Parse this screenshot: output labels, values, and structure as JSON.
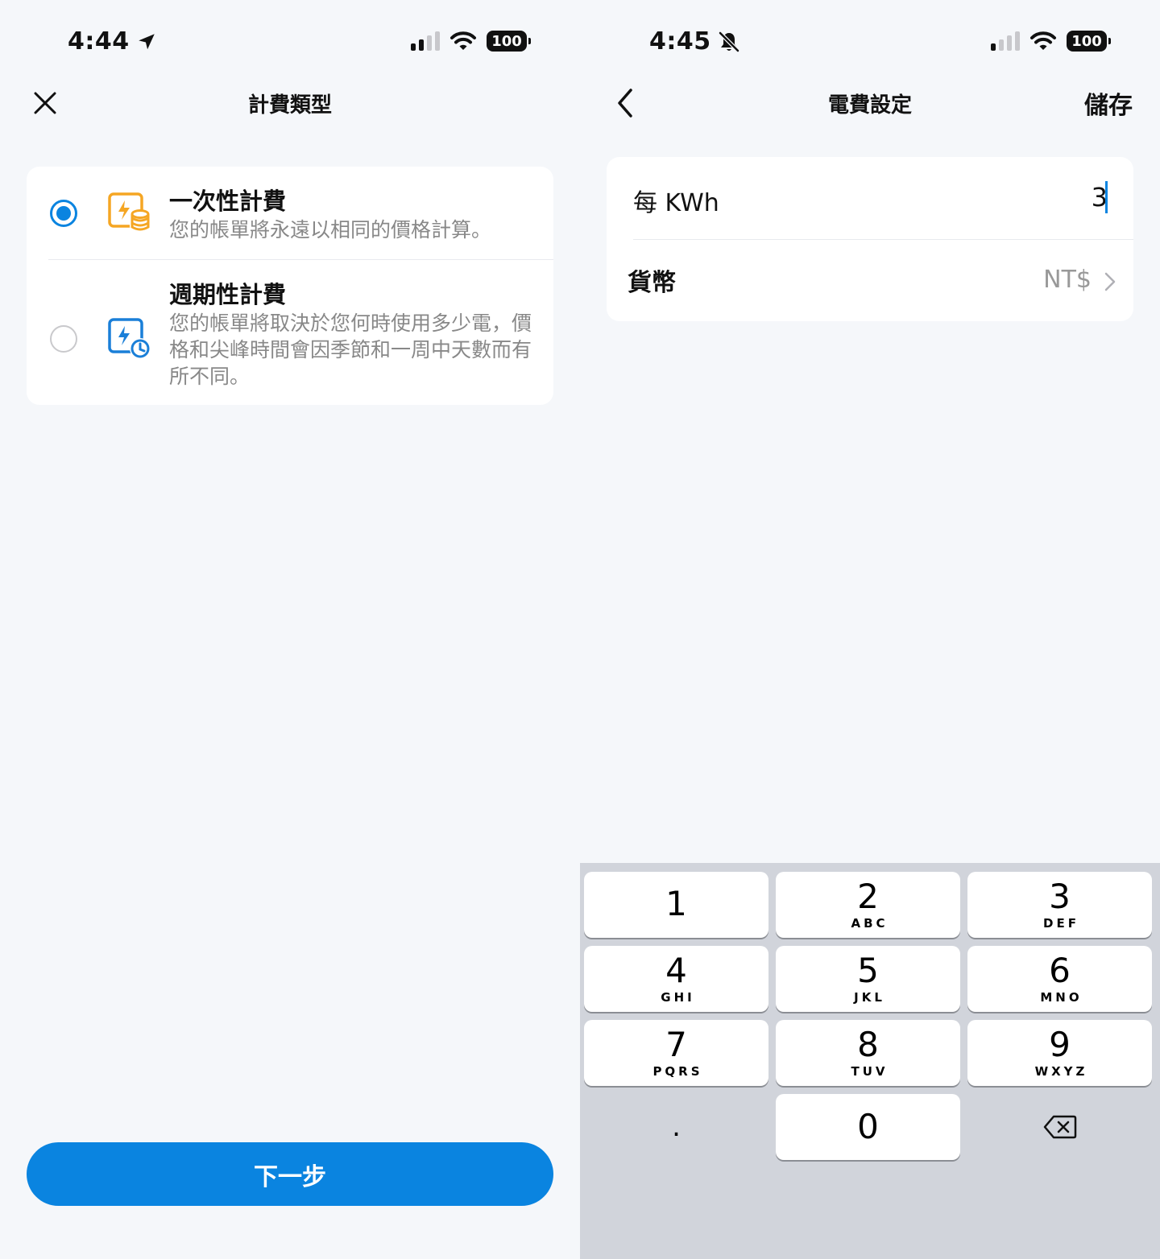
{
  "left": {
    "status": {
      "time": "4:44",
      "battery": "100"
    },
    "nav": {
      "title": "計費類型"
    },
    "options": [
      {
        "title": "一次性計費",
        "desc": "您的帳單將永遠以相同的價格計算。",
        "selected": true
      },
      {
        "title": "週期性計費",
        "desc": "您的帳單將取決於您何時使用多少電，價格和尖峰時間會因季節和一周中天數而有所不同。",
        "selected": false
      }
    ],
    "next_label": "下一步"
  },
  "right": {
    "status": {
      "time": "4:45",
      "battery": "100"
    },
    "nav": {
      "title": "電費設定",
      "save_label": "儲存"
    },
    "form": {
      "kwh_label": "每 KWh",
      "kwh_value": "3",
      "currency_label": "貨幣",
      "currency_value": "NT$"
    },
    "keyboard": {
      "keys": [
        {
          "digit": "1",
          "letters": ""
        },
        {
          "digit": "2",
          "letters": "ABC"
        },
        {
          "digit": "3",
          "letters": "DEF"
        },
        {
          "digit": "4",
          "letters": "GHI"
        },
        {
          "digit": "5",
          "letters": "JKL"
        },
        {
          "digit": "6",
          "letters": "MNO"
        },
        {
          "digit": "7",
          "letters": "PQRS"
        },
        {
          "digit": "8",
          "letters": "TUV"
        },
        {
          "digit": "9",
          "letters": "WXYZ"
        },
        {
          "digit": ".",
          "letters": ""
        },
        {
          "digit": "0",
          "letters": ""
        }
      ]
    }
  },
  "colors": {
    "accent": "#0a84e0",
    "once_icon": "#f5a623",
    "cycle_icon": "#1a7fd8"
  },
  "icons": {
    "close": "close-icon",
    "back": "chevron-left-icon",
    "once": "bolt-coins-icon",
    "cycle": "bolt-clock-icon",
    "delete": "backspace-icon",
    "location": "location-arrow-icon",
    "silent": "bell-slash-icon"
  }
}
